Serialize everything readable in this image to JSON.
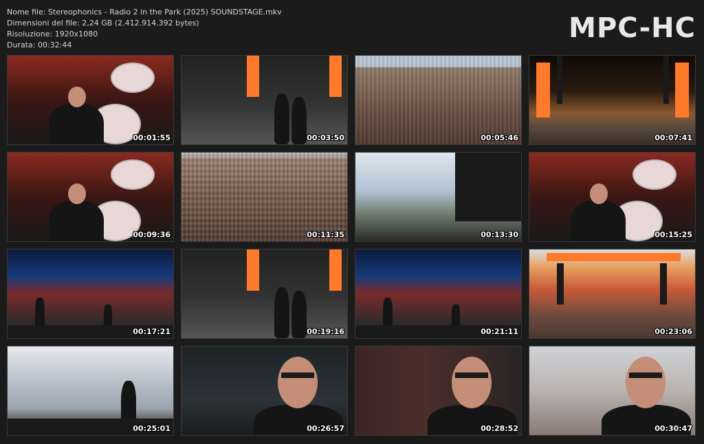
{
  "header": {
    "filename": "Nome file: Stereophonics - Radio 2 in the Park (2025) SOUNDSTAGE.mkv",
    "size": "Dimensioni del file: 2,24 GB (2.412.914.392 bytes)",
    "resolution": "Risoluzione: 1920x1080",
    "duration": "Durata: 00:32:44"
  },
  "logo": "MPC-HC",
  "thumbnails": [
    {
      "time": "00:01:55",
      "scene": "stage-red"
    },
    {
      "time": "00:03:50",
      "scene": "stage-dark"
    },
    {
      "time": "00:05:46",
      "scene": "crowd"
    },
    {
      "time": "00:07:41",
      "scene": "stage-orange"
    },
    {
      "time": "00:09:36",
      "scene": "stage-red"
    },
    {
      "time": "00:11:35",
      "scene": "crowd-full"
    },
    {
      "time": "00:13:30",
      "scene": "sky-stage"
    },
    {
      "time": "00:15:25",
      "scene": "stage-red"
    },
    {
      "time": "00:17:21",
      "scene": "blue-stage"
    },
    {
      "time": "00:19:16",
      "scene": "stage-dark"
    },
    {
      "time": "00:21:11",
      "scene": "blue-stage"
    },
    {
      "time": "00:23:06",
      "scene": "day-stage"
    },
    {
      "time": "00:25:01",
      "scene": "sky-cloud"
    },
    {
      "time": "00:26:57",
      "scene": "closeup"
    },
    {
      "time": "00:28:52",
      "scene": "closeup-red"
    },
    {
      "time": "00:30:47",
      "scene": "closeup-bright"
    }
  ]
}
